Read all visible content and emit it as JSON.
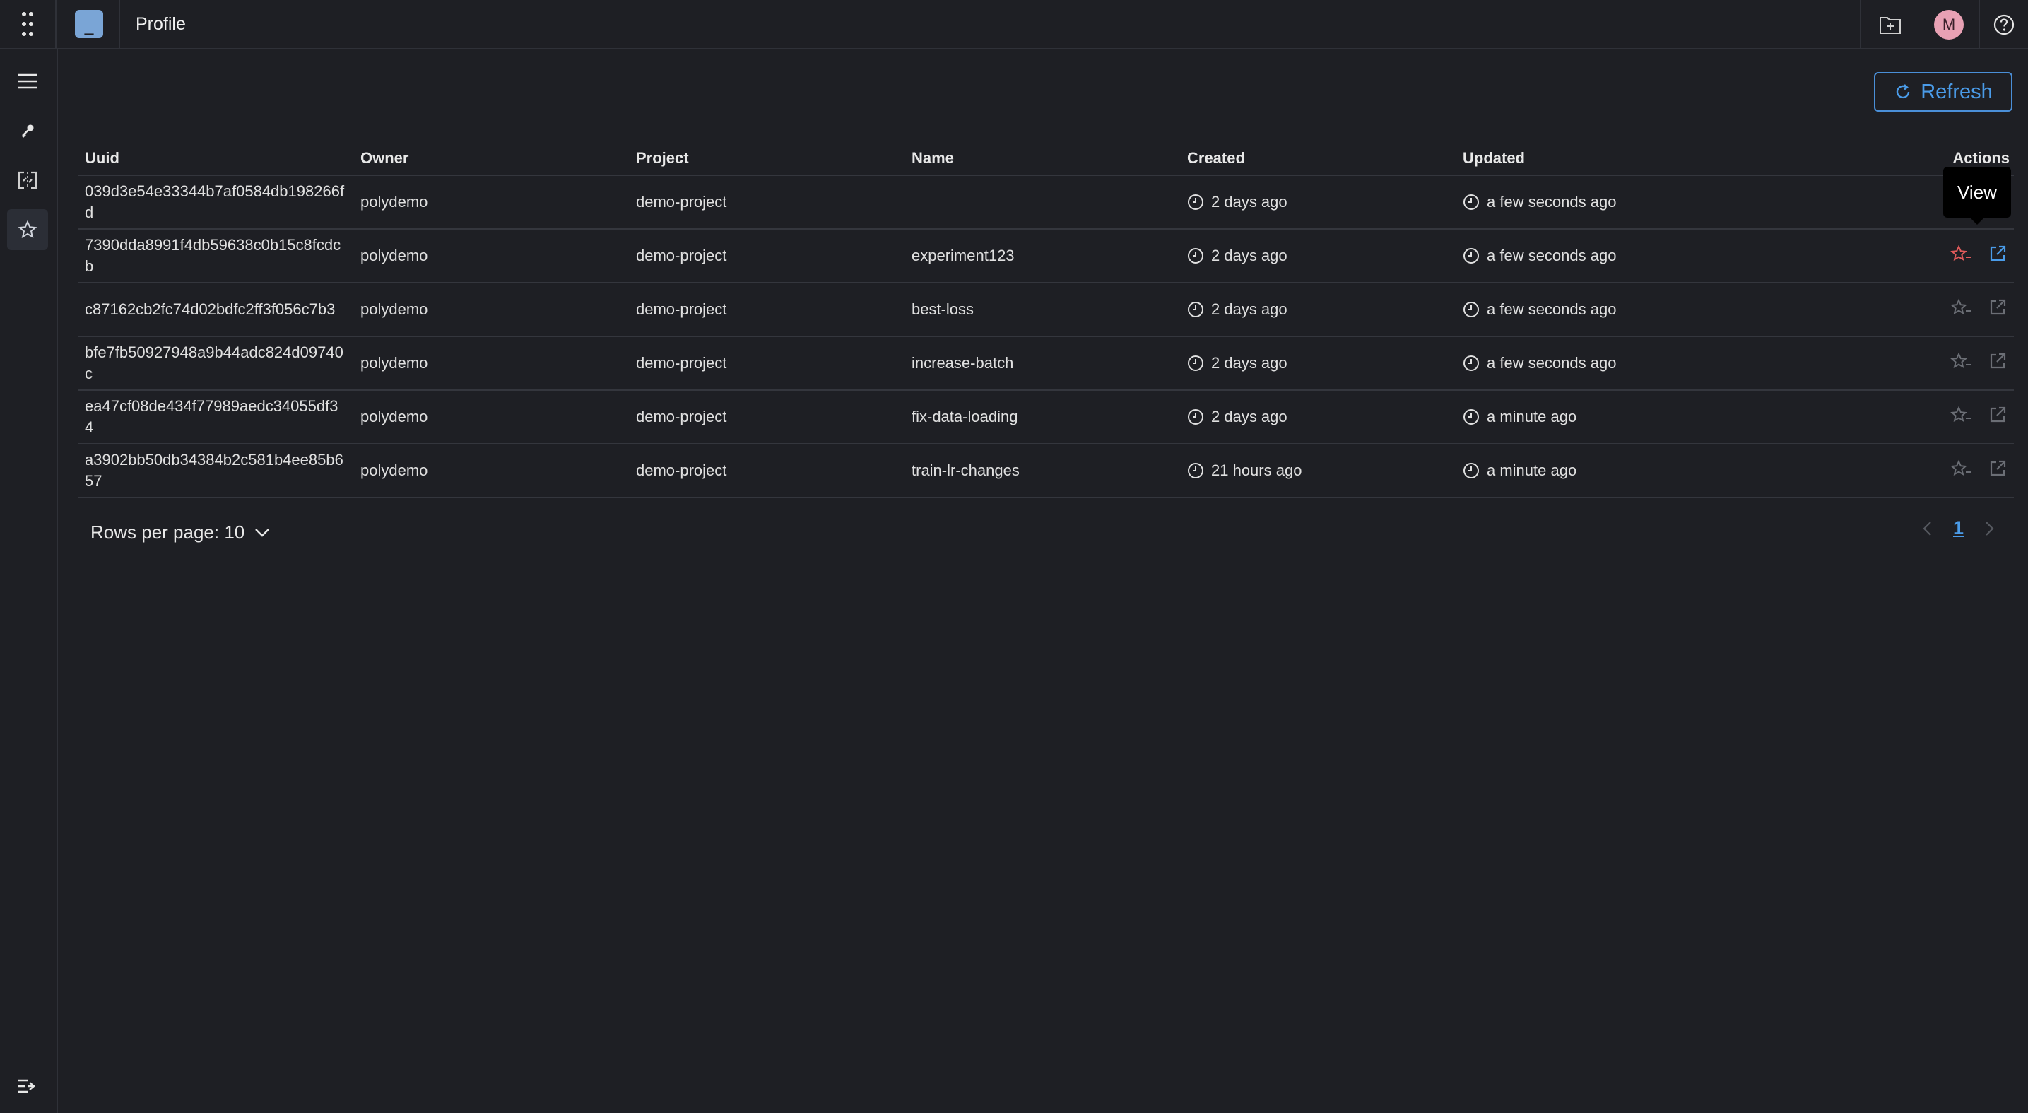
{
  "header": {
    "logo_text": "_",
    "title": "Profile",
    "avatar_initial": "M"
  },
  "icons": {
    "apps": "apps-grid-icon",
    "folder": "folder-plus-icon",
    "help": "help-circle-icon",
    "menu": "hamburger-menu-icon",
    "key": "key-icon",
    "compare": "compare-icon",
    "star": "star-icon",
    "collapse": "collapse-sidebar-icon",
    "refresh": "refresh-icon",
    "clock": "clock-icon",
    "external": "external-link-icon"
  },
  "colors": {
    "accent": "#4a9be8",
    "star_active": "#e05a5a",
    "background": "#1e1f24"
  },
  "toolbar": {
    "refresh_label": "Refresh"
  },
  "table": {
    "columns": {
      "uuid": "Uuid",
      "owner": "Owner",
      "project": "Project",
      "name": "Name",
      "created": "Created",
      "updated": "Updated",
      "actions": "Actions"
    },
    "rows": [
      {
        "uuid": "039d3e54e33344b7af0584db198266fd",
        "owner": "polydemo",
        "project": "demo-project",
        "name": "",
        "created": "2 days ago",
        "updated": "a few seconds ago",
        "starred": false
      },
      {
        "uuid": "7390dda8991f4db59638c0b15c8fcdcb",
        "owner": "polydemo",
        "project": "demo-project",
        "name": "experiment123",
        "created": "2 days ago",
        "updated": "a few seconds ago",
        "starred": true
      },
      {
        "uuid": "c87162cb2fc74d02bdfc2ff3f056c7b3",
        "owner": "polydemo",
        "project": "demo-project",
        "name": "best-loss",
        "created": "2 days ago",
        "updated": "a few seconds ago",
        "starred": false
      },
      {
        "uuid": "bfe7fb50927948a9b44adc824d09740c",
        "owner": "polydemo",
        "project": "demo-project",
        "name": "increase-batch",
        "created": "2 days ago",
        "updated": "a few seconds ago",
        "starred": false
      },
      {
        "uuid": "ea47cf08de434f77989aedc34055df34",
        "owner": "polydemo",
        "project": "demo-project",
        "name": "fix-data-loading",
        "created": "2 days ago",
        "updated": "a minute ago",
        "starred": false
      },
      {
        "uuid": "a3902bb50db34384b2c581b4ee85b657",
        "owner": "polydemo",
        "project": "demo-project",
        "name": "train-lr-changes",
        "created": "21 hours ago",
        "updated": "a minute ago",
        "starred": false
      }
    ]
  },
  "tooltip": {
    "text": "View"
  },
  "pagination": {
    "rows_per_page_label": "Rows per page: 10",
    "current_page": "1"
  }
}
